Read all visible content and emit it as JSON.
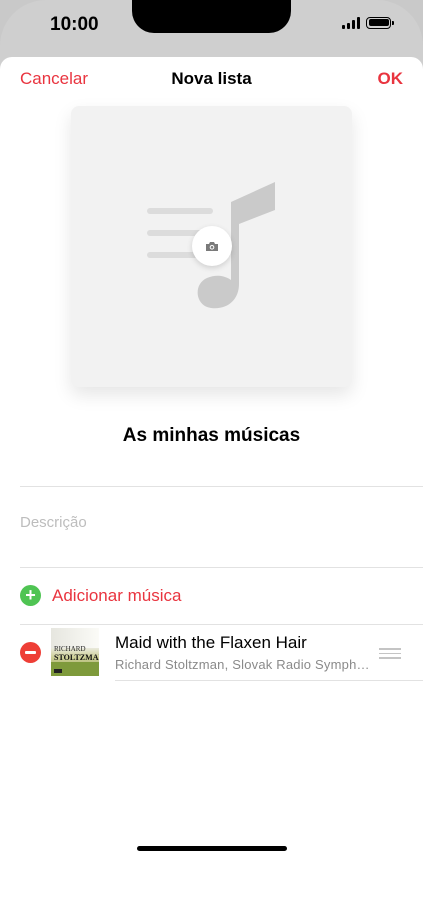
{
  "status_bar": {
    "time": "10:00"
  },
  "nav": {
    "cancel_label": "Cancelar",
    "title": "Nova lista",
    "ok_label": "OK"
  },
  "playlist": {
    "name": "As minhas músicas",
    "description_placeholder": "Descrição"
  },
  "add_music": {
    "label": "Adicionar música"
  },
  "songs": [
    {
      "title": "Maid with the Flaxen Hair",
      "subtitle": "Richard Stoltzman, Slovak Radio Symphony Orchestra",
      "art_line1": "RICHARD",
      "art_line2": "STOLTZMAN"
    }
  ],
  "colors": {
    "accent": "#e9343f",
    "add_green": "#4fc453",
    "remove_red": "#ee3e36"
  },
  "icons": {
    "artwork": "music-note-with-lines-icon",
    "camera": "camera-icon",
    "add": "plus-circle-icon",
    "remove": "minus-circle-icon",
    "reorder": "drag-handle-icon"
  }
}
